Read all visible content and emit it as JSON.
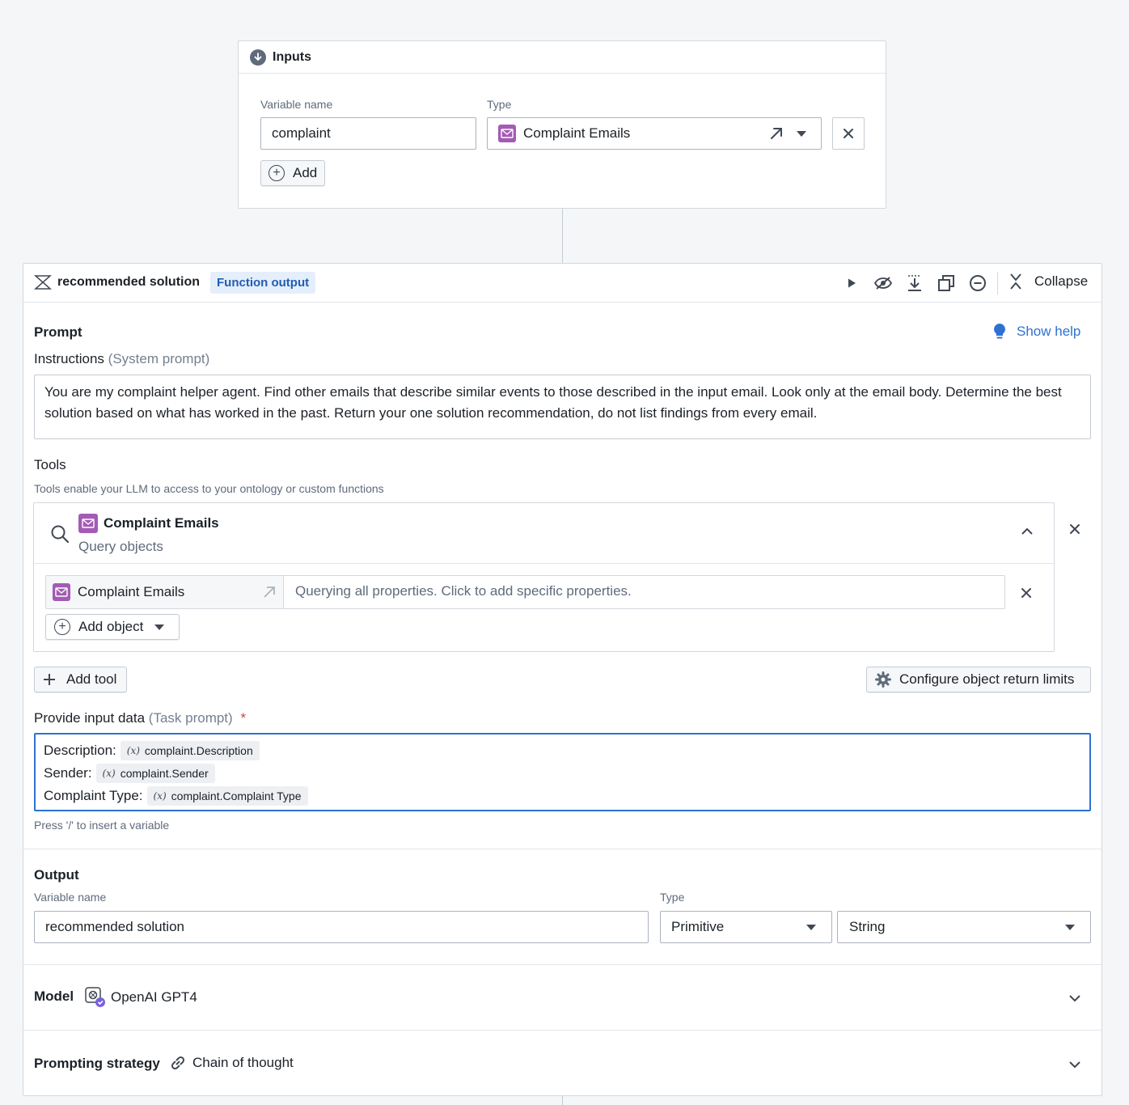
{
  "inputs": {
    "title": "Inputs",
    "variable_name_label": "Variable name",
    "type_label": "Type",
    "variable_name_value": "complaint",
    "type_value": "Complaint Emails",
    "add_label": "Add"
  },
  "block": {
    "title": "recommended solution",
    "badge": "Function output",
    "collapse_label": "Collapse",
    "prompt_title": "Prompt",
    "show_help_label": "Show help",
    "instructions_label": "Instructions",
    "instructions_sub": "(System prompt)",
    "instructions_text": "You are my complaint helper agent. Find other emails that describe similar events to those described in the input email. Look only at the email body. Determine the best solution based on what has worked in the past. Return your one solution recommendation, do not list findings from every email.",
    "tools_title": "Tools",
    "tools_help": "Tools enable your LLM to access to your ontology or custom functions",
    "tool": {
      "name": "Complaint Emails",
      "subtitle": "Query objects",
      "object_name": "Complaint Emails",
      "object_props": "Querying all properties. Click to add specific properties.",
      "add_object_label": "Add object"
    },
    "add_tool_label": "Add tool",
    "configure_limits_label": "Configure object return limits",
    "input_data_label": "Provide input data",
    "input_data_sub": "(Task prompt)",
    "required_mark": "*",
    "input_lines": [
      {
        "label": "Description:",
        "chip": "complaint.Description"
      },
      {
        "label": "Sender:",
        "chip": "complaint.Sender"
      },
      {
        "label": "Complaint Type:",
        "chip": "complaint.Complaint Type"
      }
    ],
    "chip_symbol": "(x)",
    "insert_hint": "Press '/' to insert a variable",
    "output": {
      "title": "Output",
      "variable_name_label": "Variable name",
      "type_label": "Type",
      "variable_name_value": "recommended solution",
      "type_primary": "Primitive",
      "type_secondary": "String"
    },
    "model": {
      "label": "Model",
      "value": "OpenAI GPT4"
    },
    "strategy": {
      "label": "Prompting strategy",
      "value": "Chain of thought"
    }
  },
  "colors": {
    "accent": "#2d72d2",
    "object_icon": "#a35bb5",
    "required": "#cd4246",
    "badge_bg": "#e5eefb",
    "badge_text": "#215db0"
  }
}
